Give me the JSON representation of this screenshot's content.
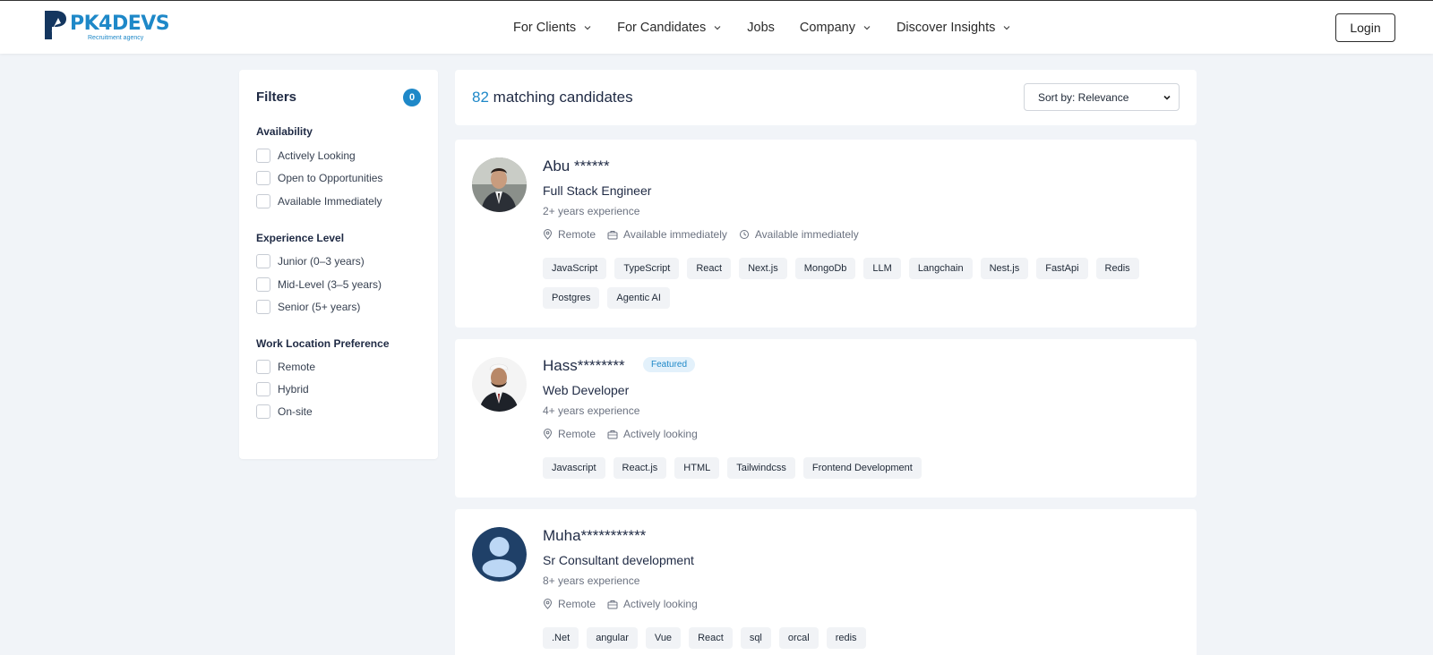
{
  "brand": {
    "name": "PK4DEVS",
    "tagline": "Recruitment agency",
    "color": "#1e88c8"
  },
  "nav": {
    "items": [
      {
        "label": "For Clients",
        "dropdown": true
      },
      {
        "label": "For Candidates",
        "dropdown": true
      },
      {
        "label": "Jobs",
        "dropdown": false
      },
      {
        "label": "Company",
        "dropdown": true
      },
      {
        "label": "Discover Insights",
        "dropdown": true
      }
    ],
    "login_label": "Login"
  },
  "filters": {
    "title": "Filters",
    "count": "0",
    "groups": [
      {
        "title": "Availability",
        "options": [
          "Actively Looking",
          "Open to Opportunities",
          "Available Immediately"
        ]
      },
      {
        "title": "Experience Level",
        "options": [
          "Junior (0–3 years)",
          "Mid-Level (3–5 years)",
          "Senior (5+ years)"
        ]
      },
      {
        "title": "Work Location Preference",
        "options": [
          "Remote",
          "Hybrid",
          "On-site"
        ]
      }
    ]
  },
  "results": {
    "count": "82",
    "label": "matching candidates",
    "sort_label": "Sort by: Relevance"
  },
  "candidates": [
    {
      "name": "Abu ******",
      "featured": "",
      "role": "Full Stack Engineer",
      "experience": "2+ years experience",
      "location": "Remote",
      "availability": "Available immediately",
      "availability2": "Available immediately",
      "avatar": "photo",
      "tags": [
        "JavaScript",
        "TypeScript",
        "React",
        "Next.js",
        "MongoDb",
        "LLM",
        "Langchain",
        "Nest.js",
        "FastApi",
        "Redis",
        "Postgres",
        "Agentic AI"
      ]
    },
    {
      "name": "Hass********",
      "featured": "Featured",
      "role": "Web Developer",
      "experience": "4+ years experience",
      "location": "Remote",
      "availability": "Actively looking",
      "avatar": "photo",
      "tags": [
        "Javascript",
        "React.js",
        "HTML",
        "Tailwindcss",
        "Frontend Development"
      ]
    },
    {
      "name": "Muha***********",
      "featured": "",
      "role": "Sr Consultant development",
      "experience": "8+ years experience",
      "location": "Remote",
      "availability": "Actively looking",
      "avatar": "default-user-icon",
      "tags": [
        ".Net",
        "angular",
        "Vue",
        "React",
        "sql",
        "orcal",
        "redis"
      ]
    }
  ]
}
